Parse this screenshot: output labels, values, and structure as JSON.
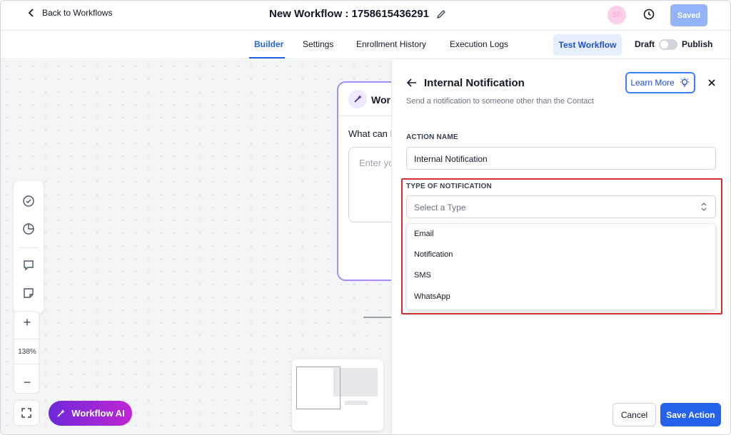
{
  "header": {
    "back_label": "Back to Workflows",
    "workflow_title": "New Workflow : 1758615436291",
    "avatar_initials": "SP",
    "saved_label": "Saved"
  },
  "tabs": [
    {
      "label": "Builder",
      "active": true
    },
    {
      "label": "Settings",
      "active": false
    },
    {
      "label": "Enrollment History",
      "active": false
    },
    {
      "label": "Execution Logs",
      "active": false
    }
  ],
  "tabbar": {
    "test_label": "Test Workflow",
    "draft_label": "Draft",
    "publish_label": "Publish",
    "publish_toggle_on": false
  },
  "canvas": {
    "ai_card_title": "Workflow AI",
    "ai_card_question": "What can I help you with?",
    "ai_card_placeholder": "Enter your prompt",
    "zoom_level": "138%",
    "zoom_in": "+",
    "zoom_out": "−",
    "ai_button_label": "Workflow AI"
  },
  "panel": {
    "title": "Internal Notification",
    "subtitle": "Send a notification to someone other than the Contact",
    "learn_more_label": "Learn More",
    "action_name_label": "ACTION NAME",
    "action_name_value": "Internal Notification",
    "type_label": "TYPE OF NOTIFICATION",
    "type_placeholder": "Select a Type",
    "type_options": [
      "Email",
      "Notification",
      "SMS",
      "WhatsApp"
    ],
    "cancel_label": "Cancel",
    "save_label": "Save Action"
  },
  "colors": {
    "accent": "#2563eb",
    "highlight": "#d32f2f",
    "ai_gradient_start": "#6d28d9",
    "ai_gradient_end": "#c026d3"
  }
}
